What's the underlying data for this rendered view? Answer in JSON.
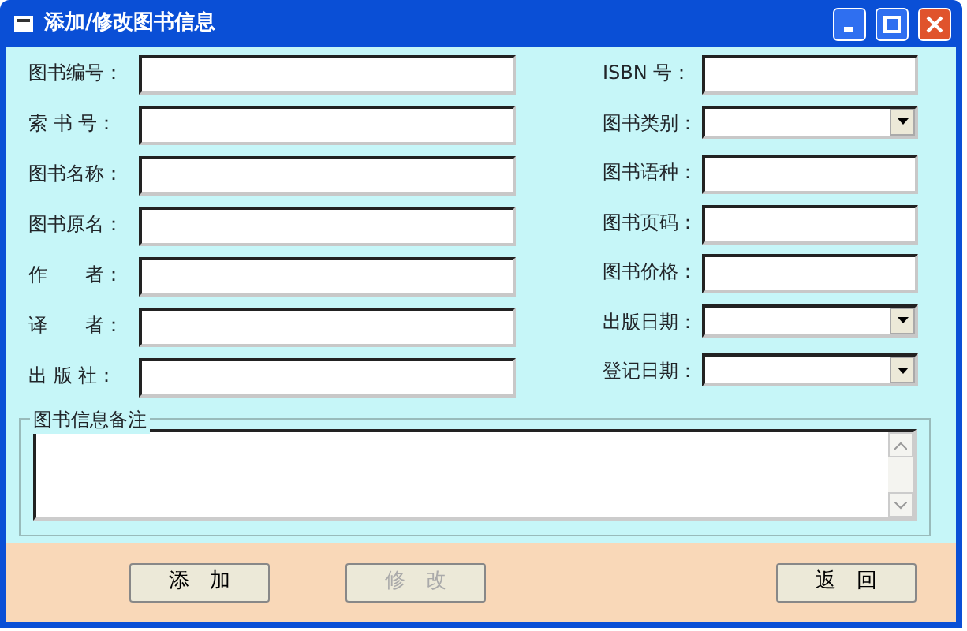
{
  "window": {
    "title": "添加/修改图书信息"
  },
  "left_fields": [
    {
      "label": "图书编号：",
      "kind": "text"
    },
    {
      "label": "索 书 号：",
      "kind": "text"
    },
    {
      "label": "图书名称：",
      "kind": "text"
    },
    {
      "label": "图书原名：",
      "kind": "text"
    },
    {
      "label": "作　　者：",
      "kind": "text"
    },
    {
      "label": "译　　者：",
      "kind": "text"
    },
    {
      "label": "出 版 社：",
      "kind": "text"
    }
  ],
  "right_fields": [
    {
      "label": "ISBN 号：",
      "kind": "text"
    },
    {
      "label": "图书类别：",
      "kind": "combo"
    },
    {
      "label": "图书语种：",
      "kind": "text"
    },
    {
      "label": "图书页码：",
      "kind": "text"
    },
    {
      "label": "图书价格：",
      "kind": "text"
    },
    {
      "label": "出版日期：",
      "kind": "combo"
    },
    {
      "label": "登记日期：",
      "kind": "combo"
    }
  ],
  "notes": {
    "title": "图书信息备注"
  },
  "buttons": [
    {
      "label": "添　加",
      "disabled": false
    },
    {
      "label": "修　改",
      "disabled": true
    },
    {
      "label": "返　回",
      "disabled": false
    }
  ]
}
